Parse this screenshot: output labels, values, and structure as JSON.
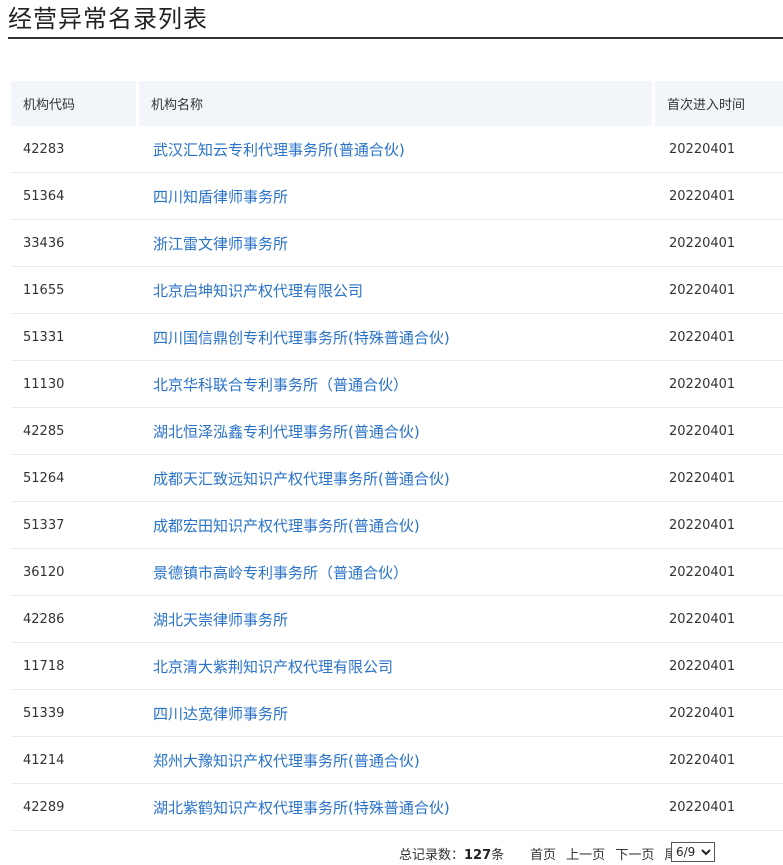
{
  "page": {
    "title": "经营异常名录列表"
  },
  "table": {
    "headers": {
      "code": "机构代码",
      "name": "机构名称",
      "date": "首次进入时间"
    },
    "rows": [
      {
        "code": "42283",
        "name": "武汉汇知云专利代理事务所(普通合伙)",
        "date": "20220401"
      },
      {
        "code": "51364",
        "name": "四川知盾律师事务所",
        "date": "20220401"
      },
      {
        "code": "33436",
        "name": "浙江雷文律师事务所",
        "date": "20220401"
      },
      {
        "code": "11655",
        "name": "北京启坤知识产权代理有限公司",
        "date": "20220401"
      },
      {
        "code": "51331",
        "name": "四川国信鼎创专利代理事务所(特殊普通合伙)",
        "date": "20220401"
      },
      {
        "code": "11130",
        "name": "北京华科联合专利事务所（普通合伙）",
        "date": "20220401"
      },
      {
        "code": "42285",
        "name": "湖北恒泽泓鑫专利代理事务所(普通合伙)",
        "date": "20220401"
      },
      {
        "code": "51264",
        "name": "成都天汇致远知识产权代理事务所(普通合伙)",
        "date": "20220401"
      },
      {
        "code": "51337",
        "name": "成都宏田知识产权代理事务所(普通合伙)",
        "date": "20220401"
      },
      {
        "code": "36120",
        "name": "景德镇市高岭专利事务所（普通合伙）",
        "date": "20220401"
      },
      {
        "code": "42286",
        "name": "湖北天崇律师事务所",
        "date": "20220401"
      },
      {
        "code": "11718",
        "name": "北京清大紫荆知识产权代理有限公司",
        "date": "20220401"
      },
      {
        "code": "51339",
        "name": "四川达宽律师事务所",
        "date": "20220401"
      },
      {
        "code": "41214",
        "name": "郑州大豫知识产权代理事务所(普通合伙)",
        "date": "20220401"
      },
      {
        "code": "42289",
        "name": "湖北紫鹤知识产权代理事务所(特殊普通合伙)",
        "date": "20220401"
      }
    ]
  },
  "pager": {
    "total_label": "总记录数：",
    "total_count": "127",
    "total_unit": "条",
    "first": "首页",
    "prev": "上一页",
    "next": "下一页",
    "last": "尾页",
    "page_select": "6/9"
  },
  "colors": {
    "link": "#2a73c9",
    "header_bg": "#f2f6fb",
    "row_border": "#e8ecf0"
  }
}
